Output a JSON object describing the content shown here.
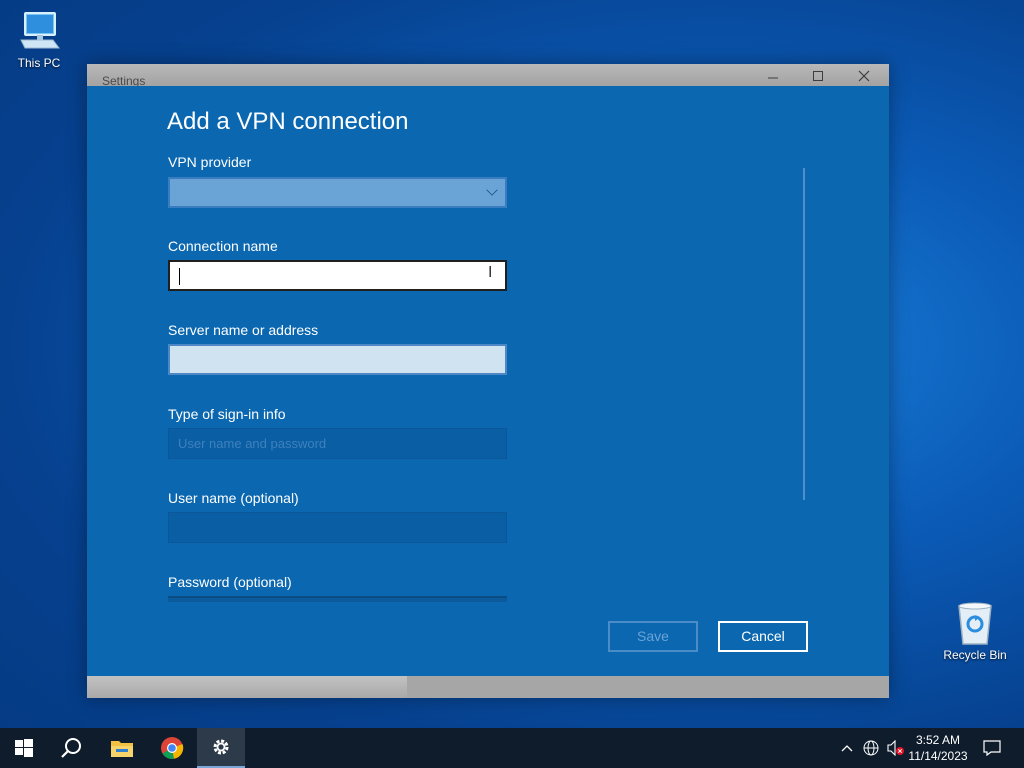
{
  "desktop": {
    "this_pc_label": "This PC",
    "recycle_bin_label": "Recycle Bin"
  },
  "window": {
    "title": "Settings",
    "minimize_icon": "minimize-icon",
    "maximize_icon": "maximize-icon",
    "close_icon": "close-icon"
  },
  "form": {
    "heading": "Add a VPN connection",
    "vpn_provider_label": "VPN provider",
    "vpn_provider_value": "",
    "connection_name_label": "Connection name",
    "connection_name_value": "",
    "server_label": "Server name or address",
    "server_value": "",
    "signin_label": "Type of sign-in info",
    "signin_value": "User name and password",
    "username_label": "User name (optional)",
    "username_value": "",
    "password_label": "Password (optional)",
    "save_label": "Save",
    "cancel_label": "Cancel"
  },
  "taskbar": {
    "items": [
      "start-icon",
      "search-icon",
      "file-explorer-icon",
      "chrome-icon",
      "settings-icon"
    ],
    "tray_icons": [
      "chevron-up-icon",
      "network-icon",
      "volume-muted-icon",
      "notification-icon"
    ],
    "time": "3:52 AM",
    "date": "11/14/2023"
  },
  "colors": {
    "accent": "#0a67b0",
    "taskbar": "#0f1c2c",
    "desktop": "#0b5cb8"
  }
}
